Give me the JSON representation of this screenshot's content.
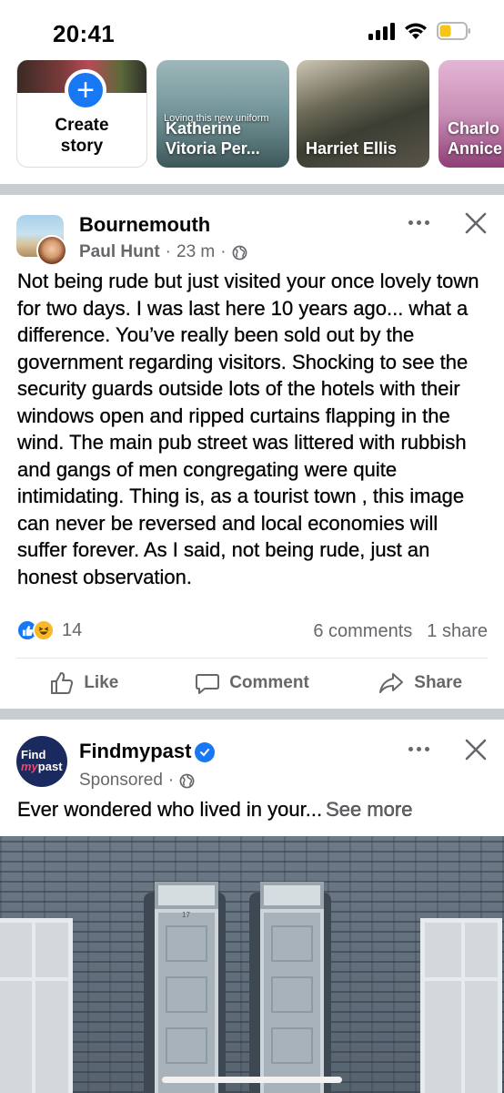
{
  "status_bar": {
    "time": "20:41",
    "battery_color": "#f5c518"
  },
  "stories": {
    "create_label": "Create\nstory",
    "items": [
      {
        "name": "Katherine\nVitoria Per...",
        "overlay": "Loving this new uniform"
      },
      {
        "name": "Harriet Ellis"
      },
      {
        "name": "Charlo\nAnnice"
      }
    ]
  },
  "post": {
    "group_name": "Bournemouth",
    "author": "Paul Hunt",
    "time": "23 m",
    "privacy_icon": "globe-icon",
    "text": "Not being rude but just visited your once lovely town for two days. I was last here 10 years ago... what a difference. You’ve really been sold out by the government regarding visitors. Shocking to see the security guards outside lots of the hotels with their windows open and ripped curtains flapping in the wind. The main pub street was littered with rubbish and gangs of men congregating were quite intimidating. Thing is, as a tourist town , this image can never be reversed and local economies will suffer forever. As I said, not being rude, just an honest observation.",
    "reaction_count": "14",
    "comments": "6 comments",
    "shares": "1 share",
    "actions": {
      "like": "Like",
      "comment": "Comment",
      "share": "Share"
    }
  },
  "ad": {
    "logo_line1": "Find",
    "logo_line2a": "my",
    "logo_line2b": "past",
    "page_name": "Findmypast",
    "sponsored": "Sponsored",
    "text": "Ever wondered who lived in your...",
    "see_more": "See more",
    "door_number": "17"
  },
  "colors": {
    "accent": "#1877f2",
    "secondary_text": "#65676b",
    "divider": "#c9ccd1"
  }
}
